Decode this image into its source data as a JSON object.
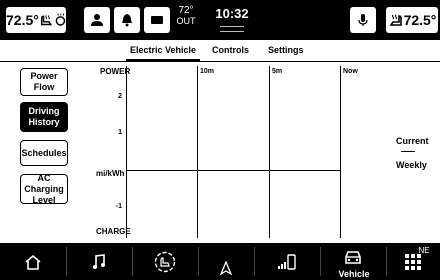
{
  "status_bar": {
    "driver_temp": "72.5°",
    "outside_temp": "72°",
    "outside_label": "OUT",
    "clock": "10:32",
    "passenger_temp": "72.5°"
  },
  "tabs": [
    {
      "label": "Electric Vehicle",
      "active": true
    },
    {
      "label": "Controls",
      "active": false
    },
    {
      "label": "Settings",
      "active": false
    }
  ],
  "side_nav": [
    {
      "label": "Power Flow",
      "selected": false
    },
    {
      "label": "Driving History",
      "selected": true
    },
    {
      "label": "Schedules",
      "selected": false
    },
    {
      "label": "AC Charging Level",
      "selected": false
    }
  ],
  "chart": {
    "y_top_label": "POWER",
    "y_bottom_label": "CHARGE",
    "unit_label": "mi/kWh",
    "y_ticks": [
      "2",
      "1",
      "-1"
    ],
    "time_labels": [
      "10m",
      "5m",
      "Now"
    ],
    "legend": {
      "current": "Current",
      "weekly": "Weekly"
    }
  },
  "bottom_bar": {
    "compass": "NE",
    "vehicle_label": "Vehicle"
  },
  "colors": {
    "bar_background": "#000000",
    "content_background": "#ffffff",
    "accent": "#000000"
  }
}
